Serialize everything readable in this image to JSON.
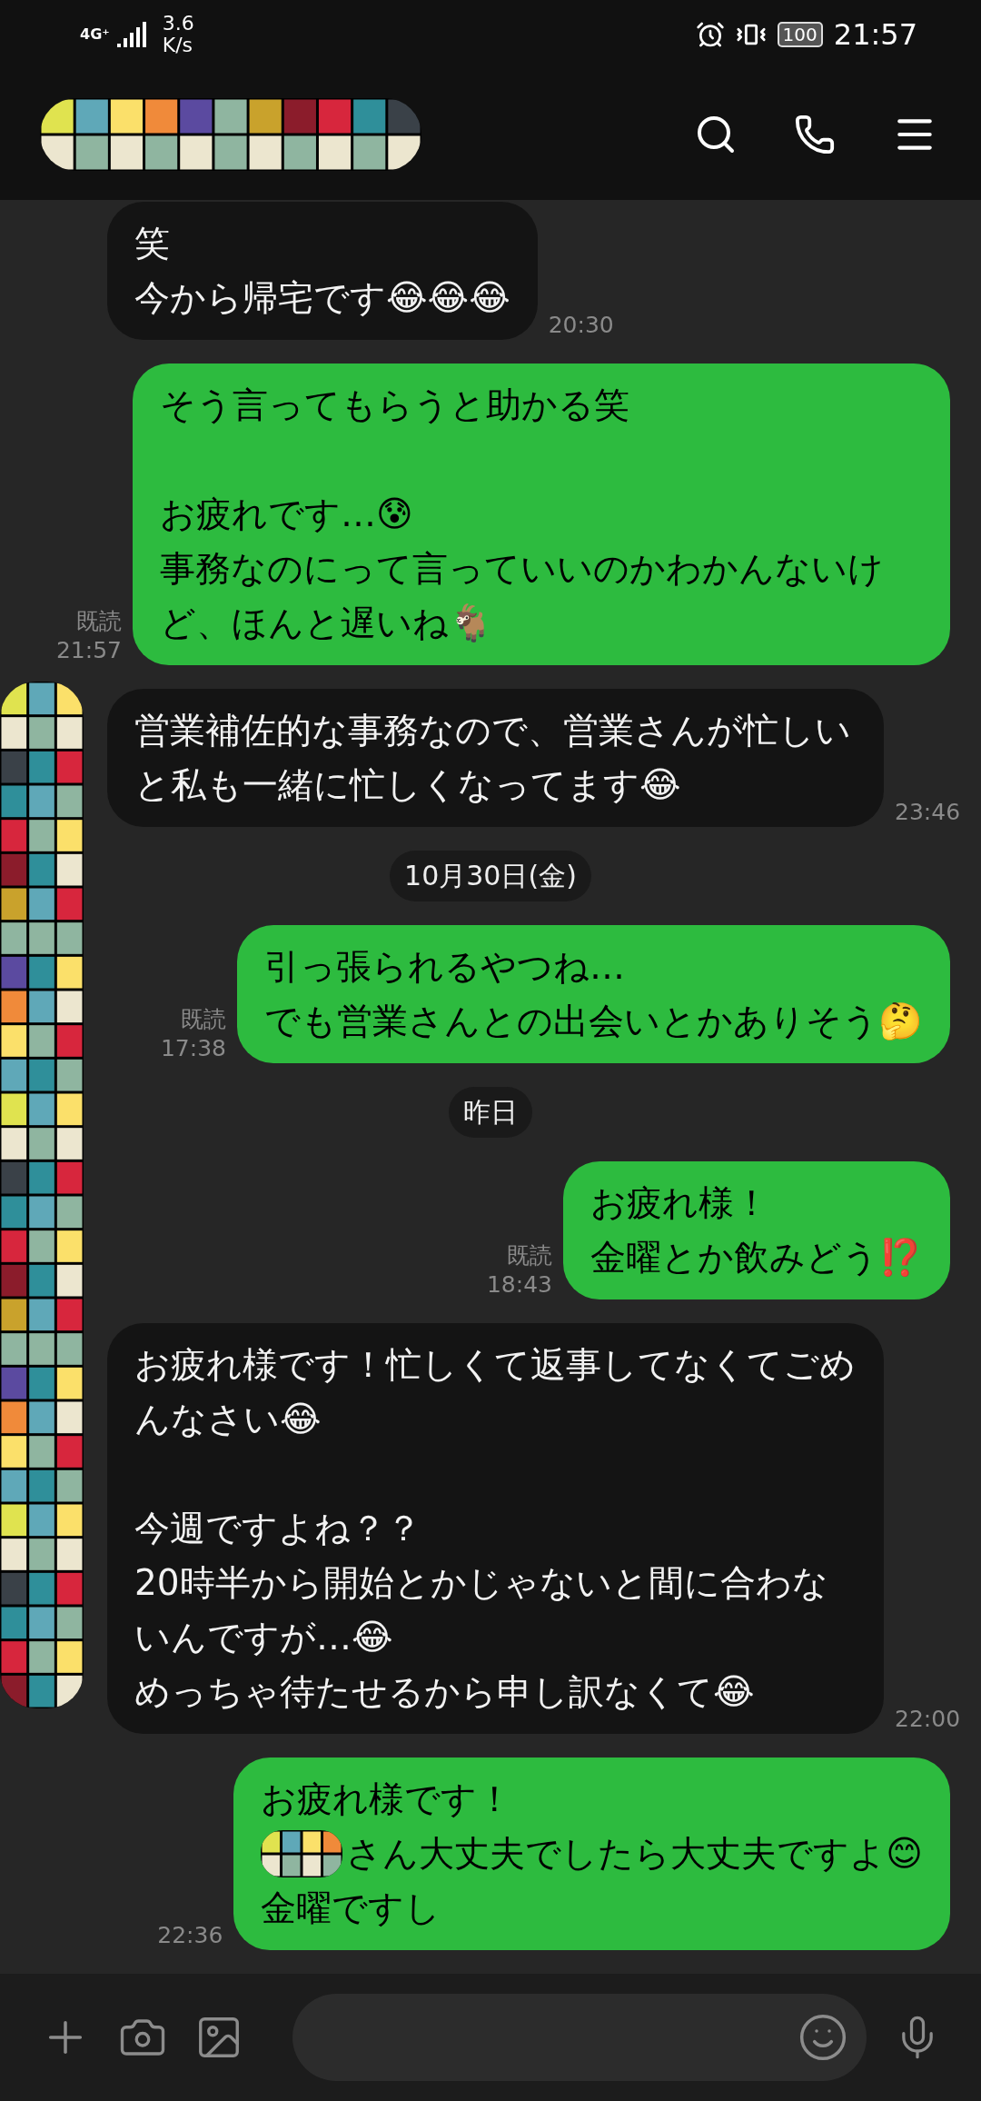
{
  "status_bar": {
    "network": "4G⁺",
    "speed_value": "3.6",
    "speed_unit": "K/s",
    "battery": "100",
    "time": "21:57"
  },
  "messages": [
    {
      "kind": "received",
      "paragraphs": [
        [
          "笑",
          "今から帰宅です😂😂😂"
        ]
      ],
      "time": "20:30"
    },
    {
      "kind": "sent",
      "paragraphs": [
        [
          "そう言ってもらうと助かる笑"
        ],
        [
          "お疲れです…😰",
          "事務なのにって言っていいのかわかんないけど、ほんと遅いね🐐"
        ]
      ],
      "read": "既読",
      "time": "21:57"
    },
    {
      "kind": "received",
      "paragraphs": [
        [
          "営業補佐的な事務なので、営業さんが忙しいと私も一緒に忙しくなってます😂"
        ]
      ],
      "time": "23:46"
    },
    {
      "kind": "date",
      "label": "10月30日(金)"
    },
    {
      "kind": "sent",
      "paragraphs": [
        [
          "引っ張られるやつね…",
          "でも営業さんとの出会いとかありそう🤔"
        ]
      ],
      "read": "既読",
      "time": "17:38"
    },
    {
      "kind": "date",
      "label": "昨日"
    },
    {
      "kind": "sent",
      "paragraphs": [
        [
          "お疲れ様！",
          "金曜とか飲みどう⁉️"
        ]
      ],
      "read": "既読",
      "time": "18:43"
    },
    {
      "kind": "received",
      "paragraphs": [
        [
          "お疲れ様です！忙しくて返事してなくてごめんなさい😂"
        ],
        [
          "今週ですよね？？",
          "20時半から開始とかじゃないと間に合わないんですが…😂",
          "めっちゃ待たせるから申し訳なくて😂"
        ]
      ],
      "time": "22:00"
    },
    {
      "kind": "sent",
      "paragraphs": [
        [
          "お疲れ様です！",
          {
            "redacted": true,
            "text": "さん大丈夫でしたら大丈夫ですよ😊"
          },
          "金曜ですし"
        ]
      ],
      "time": "22:36"
    }
  ]
}
